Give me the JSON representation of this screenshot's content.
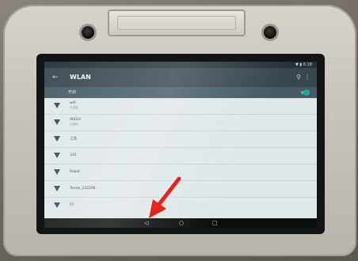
{
  "status_bar": {
    "icons_text": "▼ ▮ 6:18"
  },
  "app_bar": {
    "back_icon": "arrow-back-icon",
    "title": "WLAN",
    "search_icon": "search-icon",
    "more_icon": "more-vert-icon"
  },
  "switch_bar": {
    "label": "开启",
    "state": "on"
  },
  "networks": [
    {
      "ssid": "wifi",
      "status": "已连接"
    },
    {
      "ssid": "AtSG4",
      "status": "已保存"
    },
    {
      "ssid": "上品",
      "status": ""
    },
    {
      "ssid": "335",
      "status": ""
    },
    {
      "ssid": "Robot",
      "status": ""
    },
    {
      "ssid": "Tenda_232298",
      "status": ""
    },
    {
      "ssid": "FC",
      "status": ""
    }
  ],
  "nav_bar": {
    "back": "◁",
    "home": "○",
    "recent": "□"
  },
  "annotation": {
    "color": "#e8231a",
    "points_to": "nav-back-button"
  }
}
